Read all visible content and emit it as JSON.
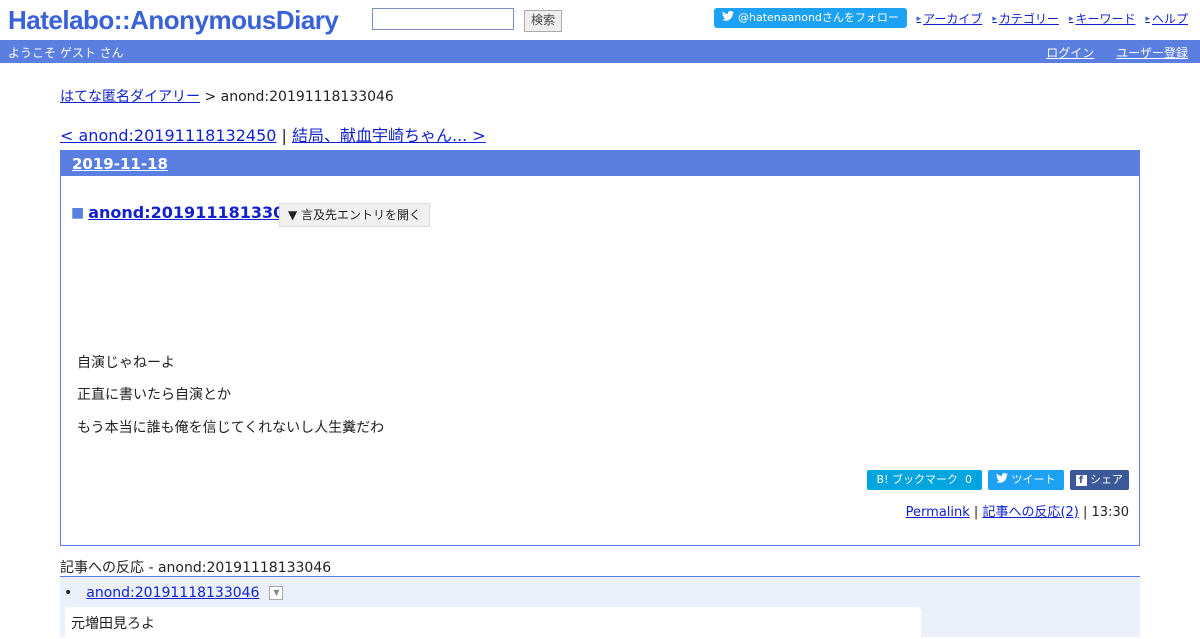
{
  "header": {
    "logo": "Hatelabo::AnonymousDiary",
    "search_placeholder": "",
    "search_button": "検索",
    "follow_button": "@hatenaanondさんをフォロー",
    "nav": [
      "アーカイブ",
      "カテゴリー",
      "キーワード",
      "ヘルプ"
    ]
  },
  "userbar": {
    "welcome": "ようこそ ゲスト さん",
    "login": "ログイン",
    "register": "ユーザー登録"
  },
  "breadcrumb": {
    "home": "はてな匿名ダイアリー",
    "separator": " > ",
    "current": "anond:20191118133046"
  },
  "pager": {
    "prev": "< anond:20191118132450",
    "sep": " | ",
    "next": "結局、献血宇崎ちゃん... >"
  },
  "entry": {
    "date": "2019-11-18",
    "square": "■",
    "title": "anond:20191118133006",
    "expand_button": "▼ 言及先エントリを開く",
    "lines": [
      "自演じゃねーよ",
      "正直に書いたら自演とか",
      "もう本当に誰も俺を信じてくれないし人生糞だわ"
    ],
    "share": {
      "bookmark": "B! ブックマーク",
      "bookmark_count": "0",
      "tweet": "ツイート",
      "share": "シェア"
    },
    "permalink": "Permalink",
    "sep1": " | ",
    "responses": "記事への反応(2)",
    "sep2": " | ",
    "time": "13:30"
  },
  "references": {
    "title": "記事への反応 - anond:20191118133046",
    "item_link": "anond:20191118133046",
    "item_text": "元増田見ろよ"
  },
  "colors": {
    "brand": "#3a62d8",
    "bar": "#5b7fe0",
    "twitter": "#1da1f2",
    "facebook": "#3b5998"
  }
}
